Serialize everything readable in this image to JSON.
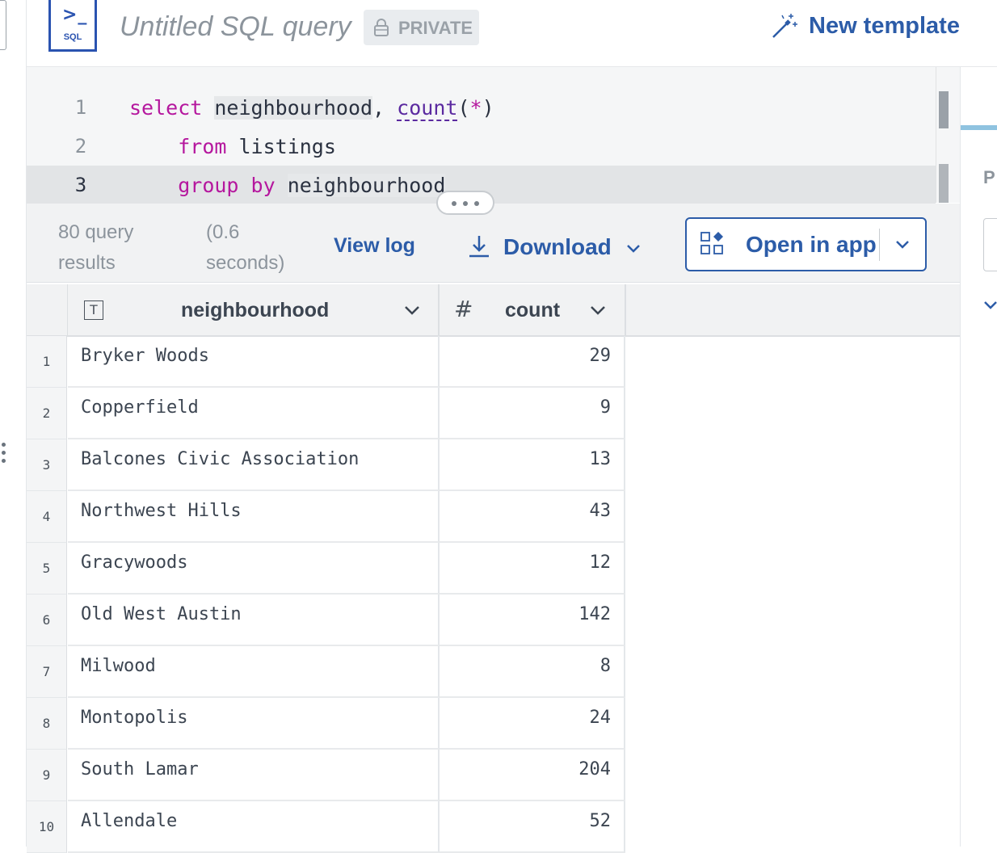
{
  "header": {
    "sql_prompt": ">_",
    "sql_badge": "SQL",
    "title": "Untitled SQL query",
    "privacy_label": "PRIVATE",
    "new_template_label": "New template"
  },
  "editor": {
    "lines": [
      {
        "number": "1",
        "tokens": [
          "select",
          "neighbourhood",
          ",",
          "count",
          "(",
          "*",
          ")"
        ]
      },
      {
        "number": "2",
        "tokens": [
          "from",
          "listings"
        ]
      },
      {
        "number": "3",
        "tokens": [
          "group by",
          "neighbourhood"
        ]
      }
    ]
  },
  "results_bar": {
    "count_text": "80 query results",
    "time_text": "(0.6 seconds)",
    "view_log_label": "View log",
    "download_label": "Download",
    "open_in_app_label": "Open in app"
  },
  "table": {
    "columns": [
      {
        "name": "neighbourhood",
        "type_icon": "text-type-icon"
      },
      {
        "name": "count",
        "type_icon": "number-type-icon"
      }
    ],
    "rows": [
      {
        "n": "1",
        "neighbourhood": "Bryker Woods",
        "count": "29"
      },
      {
        "n": "2",
        "neighbourhood": "Copperfield",
        "count": "9"
      },
      {
        "n": "3",
        "neighbourhood": "Balcones Civic Association",
        "count": "13"
      },
      {
        "n": "4",
        "neighbourhood": "Northwest Hills",
        "count": "43"
      },
      {
        "n": "5",
        "neighbourhood": "Gracywoods",
        "count": "12"
      },
      {
        "n": "6",
        "neighbourhood": "Old West Austin",
        "count": "142"
      },
      {
        "n": "7",
        "neighbourhood": "Milwood",
        "count": "8"
      },
      {
        "n": "8",
        "neighbourhood": "Montopolis",
        "count": "24"
      },
      {
        "n": "9",
        "neighbourhood": "South Lamar",
        "count": "204"
      },
      {
        "n": "10",
        "neighbourhood": "Allendale",
        "count": "52"
      }
    ]
  },
  "right_panel": {
    "letter": "P"
  },
  "colors": {
    "accent": "#2c5ca8",
    "badge_blue": "#2a53b0",
    "keyword": "#b5179e",
    "function": "#5b2aa0"
  }
}
